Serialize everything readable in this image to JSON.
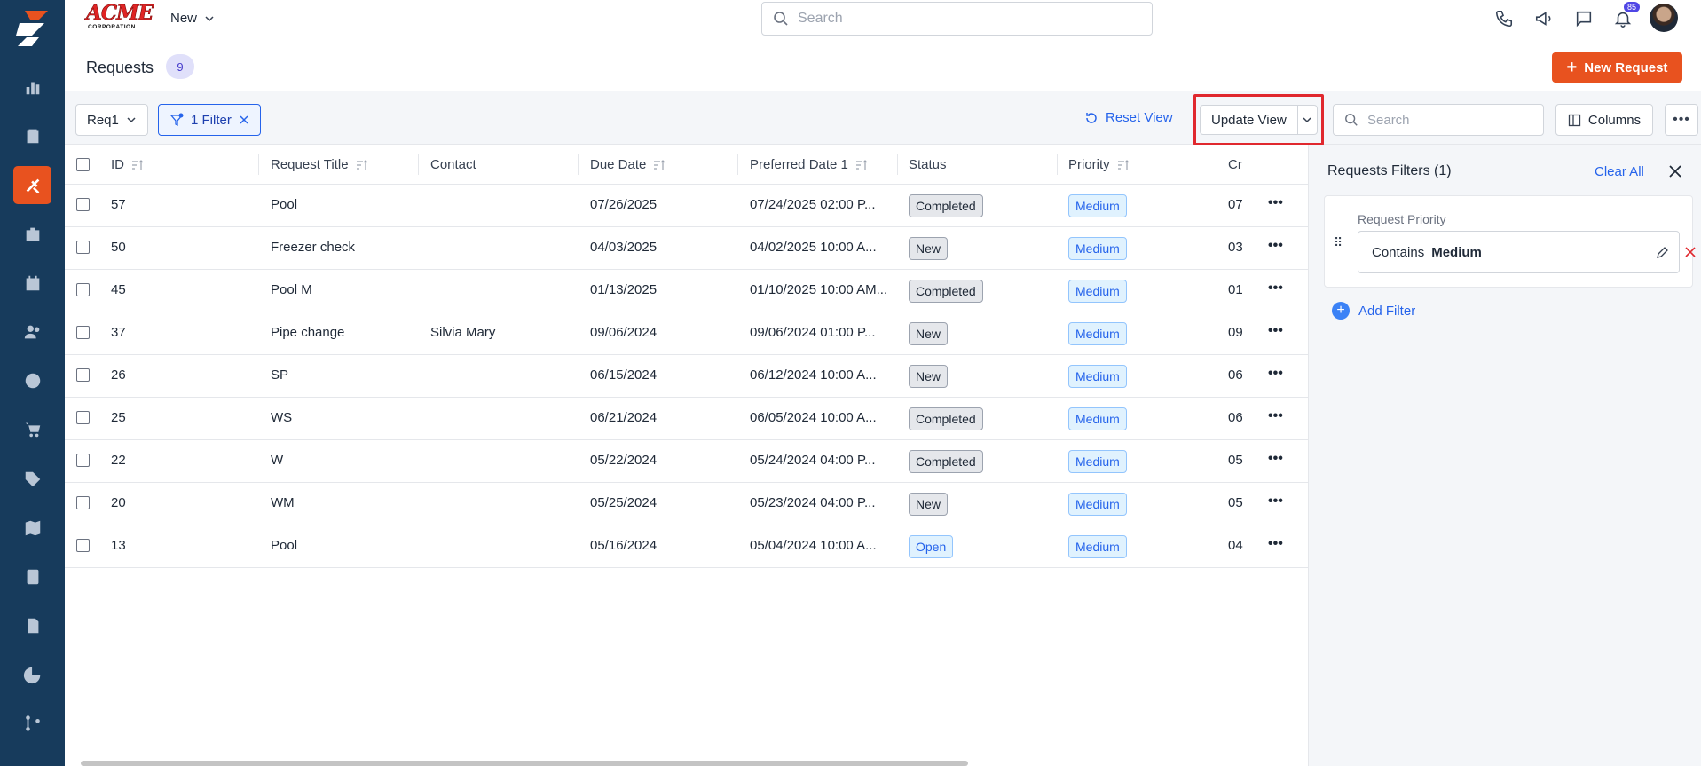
{
  "brand": {
    "name": "ACME",
    "sub": "CORPORATION"
  },
  "topbar": {
    "new_label": "New",
    "search_placeholder": "Search",
    "notification_count": "85"
  },
  "page": {
    "title": "Requests",
    "count": "9",
    "new_button": "New Request"
  },
  "toolbar": {
    "view_name": "Req1",
    "filter_label": "1 Filter",
    "reset_view": "Reset View",
    "update_view": "Update View",
    "search_placeholder": "Search",
    "columns_label": "Columns"
  },
  "table": {
    "headers": [
      "ID",
      "Request Title",
      "Contact",
      "Due Date",
      "Preferred Date 1",
      "Status",
      "Priority",
      "Cr"
    ],
    "rows": [
      {
        "id": "57",
        "title": "Pool",
        "contact": "",
        "due": "07/26/2025",
        "pref": "07/24/2025 02:00 P...",
        "status": "Completed",
        "priority": "Medium",
        "cr": "07"
      },
      {
        "id": "50",
        "title": "Freezer check",
        "contact": "",
        "due": "04/03/2025",
        "pref": "04/02/2025 10:00 A...",
        "status": "New",
        "priority": "Medium",
        "cr": "03"
      },
      {
        "id": "45",
        "title": "Pool M",
        "contact": "",
        "due": "01/13/2025",
        "pref": "01/10/2025 10:00 AM...",
        "status": "Completed",
        "priority": "Medium",
        "cr": "01"
      },
      {
        "id": "37",
        "title": "Pipe change",
        "contact": "Silvia Mary",
        "due": "09/06/2024",
        "pref": "09/06/2024 01:00 P...",
        "status": "New",
        "priority": "Medium",
        "cr": "09"
      },
      {
        "id": "26",
        "title": "SP",
        "contact": "",
        "due": "06/15/2024",
        "pref": "06/12/2024 10:00 A...",
        "status": "New",
        "priority": "Medium",
        "cr": "06"
      },
      {
        "id": "25",
        "title": "WS",
        "contact": "",
        "due": "06/21/2024",
        "pref": "06/05/2024 10:00 A...",
        "status": "Completed",
        "priority": "Medium",
        "cr": "06"
      },
      {
        "id": "22",
        "title": "W",
        "contact": "",
        "due": "05/22/2024",
        "pref": "05/24/2024 04:00 P...",
        "status": "Completed",
        "priority": "Medium",
        "cr": "05"
      },
      {
        "id": "20",
        "title": "WM",
        "contact": "",
        "due": "05/25/2024",
        "pref": "05/23/2024 04:00 P...",
        "status": "New",
        "priority": "Medium",
        "cr": "05"
      },
      {
        "id": "13",
        "title": "Pool",
        "contact": "",
        "due": "05/16/2024",
        "pref": "05/04/2024 10:00 A...",
        "status": "Open",
        "priority": "Medium",
        "cr": "04"
      }
    ]
  },
  "filters_panel": {
    "title": "Requests Filters (1)",
    "clear_all": "Clear All",
    "filter": {
      "label": "Request Priority",
      "operator": "Contains",
      "value": "Medium"
    },
    "add_filter": "Add Filter"
  },
  "colors": {
    "sidebar": "#173b5c",
    "accent": "#e8521f",
    "link": "#2563eb",
    "highlight": "#e0282e"
  }
}
